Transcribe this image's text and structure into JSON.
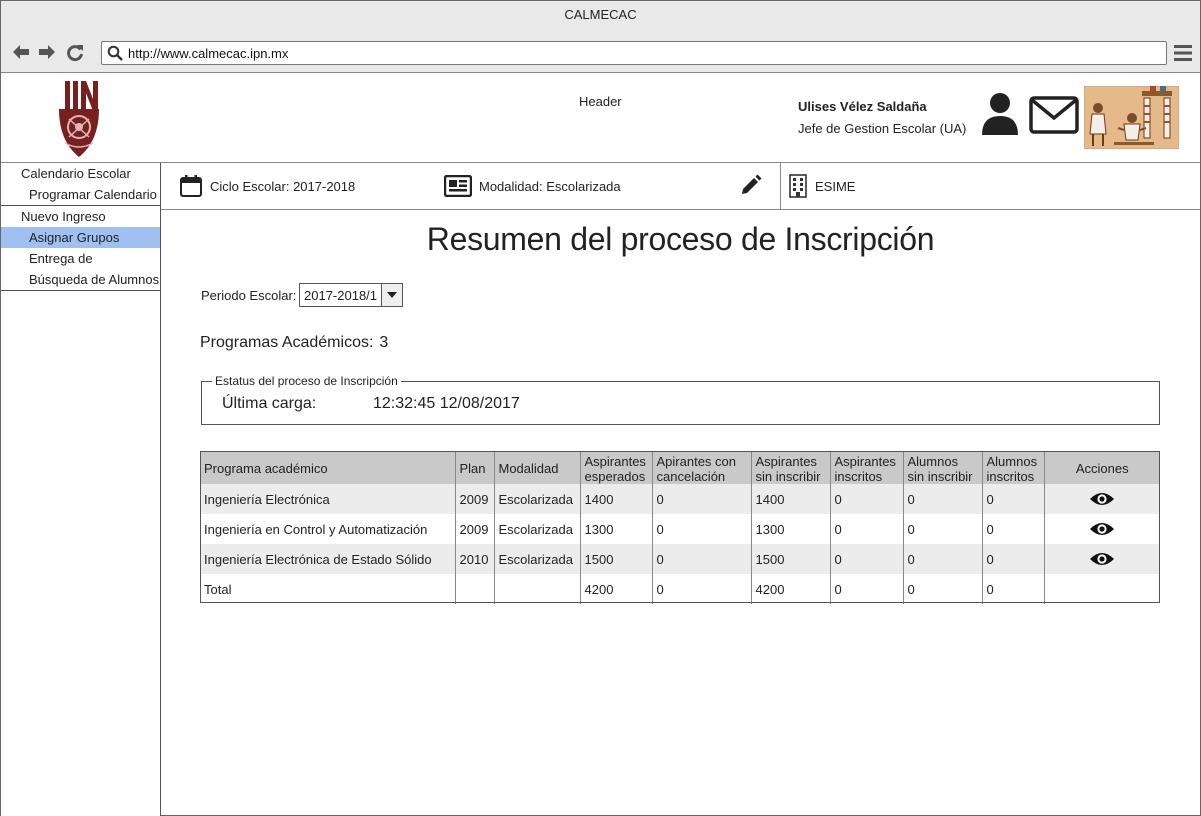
{
  "window": {
    "title": "CALMECAC"
  },
  "browser": {
    "url": "http://www.calmecac.ipn.mx"
  },
  "header": {
    "label": "Header",
    "user_name": "Ulises Vélez Saldaña",
    "user_role": "Jefe de Gestion Escolar (UA)"
  },
  "sidebar": {
    "groups": [
      {
        "items": [
          {
            "label": "Calendario Escolar",
            "sub": false
          },
          {
            "label": "Programar Calendario",
            "sub": true
          }
        ]
      },
      {
        "items": [
          {
            "label": "Nuevo Ingreso",
            "sub": false
          },
          {
            "label": "Asignar Grupos",
            "sub": true,
            "active": true
          },
          {
            "label": "Entrega de",
            "sub": true
          },
          {
            "label": "Búsqueda de Alumnos",
            "sub": true
          }
        ]
      }
    ]
  },
  "infobar": {
    "ciclo": "Ciclo Escolar: 2017-2018",
    "modalidad": "Modalidad: Escolarizada",
    "escuela": "ESIME"
  },
  "main": {
    "title": "Resumen del proceso de Inscripción",
    "periodo_label": "Periodo Escolar:",
    "periodo_value": "2017-2018/1",
    "programas_label": "Programas Académicos:",
    "programas_count": "3",
    "status_legend": "Estatus del proceso de Inscripción",
    "ultima_carga_label": "Última carga:",
    "ultima_carga_value": "12:32:45 12/08/2017"
  },
  "table": {
    "headers": [
      [
        "Programa académico"
      ],
      [
        "Plan"
      ],
      [
        "Modalidad"
      ],
      [
        "Aspirantes",
        "esperados"
      ],
      [
        "Apirantes con",
        "cancelación"
      ],
      [
        "Aspirantes",
        "sin inscribir"
      ],
      [
        "Aspirantes",
        "inscritos"
      ],
      [
        "Alumnos",
        "sin inscribir"
      ],
      [
        "Alumnos",
        "inscritos"
      ],
      [
        "Acciones"
      ]
    ],
    "rows": [
      [
        "Ingeniería Electrónica",
        "2009",
        "Escolarizada",
        "1400",
        "0",
        "1400",
        "0",
        "0",
        "0"
      ],
      [
        "Ingeniería en Control y Automatización",
        "2009",
        "Escolarizada",
        "1300",
        "0",
        "1300",
        "0",
        "0",
        "0"
      ],
      [
        "Ingeniería Electrónica de Estado Sólido",
        "2010",
        "Escolarizada",
        "1500",
        "0",
        "1500",
        " 0",
        "0",
        "0"
      ],
      [
        "Total",
        "",
        "",
        "4200",
        "0",
        "4200",
        "0",
        "0",
        "0"
      ]
    ],
    "row_actions": [
      "view-icon",
      "view-icon",
      "view-icon",
      ""
    ]
  }
}
